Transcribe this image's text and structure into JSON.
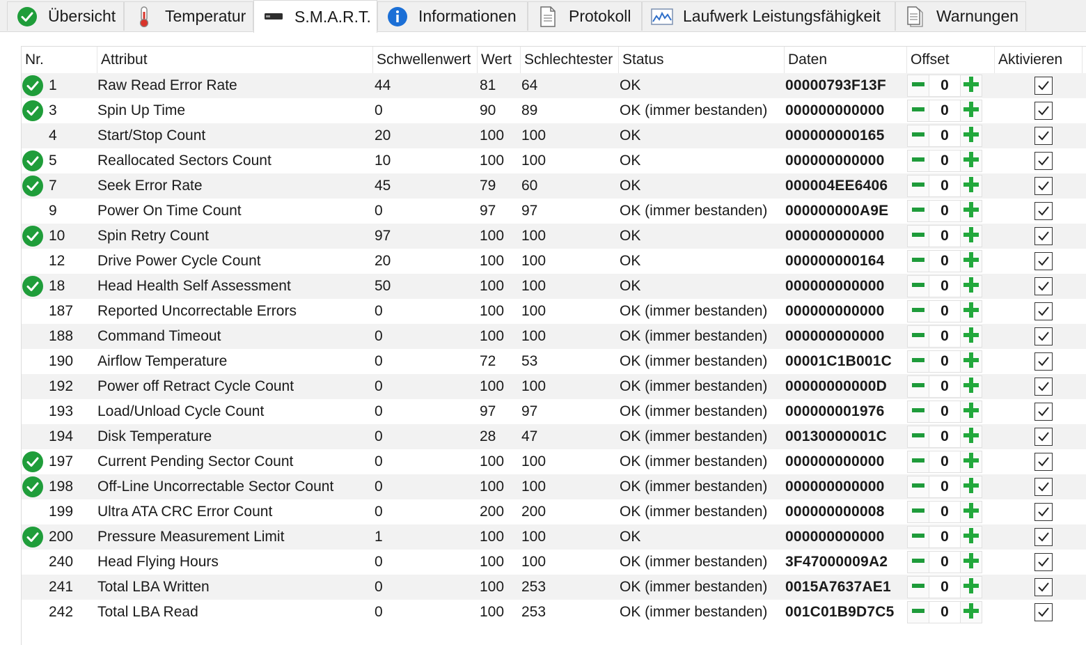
{
  "tabs": [
    {
      "label": "Übersicht",
      "icon": "check-ok-icon",
      "active": false
    },
    {
      "label": "Temperatur",
      "icon": "thermometer-icon",
      "active": false
    },
    {
      "label": "S.M.A.R.T.",
      "icon": "drive-icon",
      "active": true
    },
    {
      "label": "Informationen",
      "icon": "info-icon",
      "active": false
    },
    {
      "label": "Protokoll",
      "icon": "document-icon",
      "active": false
    },
    {
      "label": "Laufwerk Leistungsfähigkeit",
      "icon": "performance-chart-icon",
      "active": false
    },
    {
      "label": "Warnungen",
      "icon": "warnings-document-icon",
      "active": false
    }
  ],
  "columns": {
    "nr": "Nr.",
    "attribut": "Attribut",
    "schwellenwert": "Schwellenwert",
    "wert": "Wert",
    "schlechtester": "Schlechtester",
    "status": "Status",
    "daten": "Daten",
    "offset": "Offset",
    "aktivieren": "Aktivieren"
  },
  "colors": {
    "ok_green": "#1f9d3a",
    "minus_green": "#1e9b3a",
    "plus_green": "#22a83c",
    "row_alt": "#f2f2f2"
  },
  "rows": [
    {
      "ok_icon": true,
      "nr": "1",
      "attribut": "Raw Read Error Rate",
      "schwellenwert": "44",
      "wert": "81",
      "schlechtester": "64",
      "status": "OK",
      "daten": "00000793F13F",
      "offset": "0",
      "aktiv": true
    },
    {
      "ok_icon": true,
      "nr": "3",
      "attribut": "Spin Up Time",
      "schwellenwert": "0",
      "wert": "90",
      "schlechtester": "89",
      "status": "OK (immer bestanden)",
      "daten": "000000000000",
      "offset": "0",
      "aktiv": true
    },
    {
      "ok_icon": false,
      "nr": "4",
      "attribut": "Start/Stop Count",
      "schwellenwert": "20",
      "wert": "100",
      "schlechtester": "100",
      "status": "OK",
      "daten": "000000000165",
      "offset": "0",
      "aktiv": true
    },
    {
      "ok_icon": true,
      "nr": "5",
      "attribut": "Reallocated Sectors Count",
      "schwellenwert": "10",
      "wert": "100",
      "schlechtester": "100",
      "status": "OK",
      "daten": "000000000000",
      "offset": "0",
      "aktiv": true
    },
    {
      "ok_icon": true,
      "nr": "7",
      "attribut": "Seek Error Rate",
      "schwellenwert": "45",
      "wert": "79",
      "schlechtester": "60",
      "status": "OK",
      "daten": "000004EE6406",
      "offset": "0",
      "aktiv": true
    },
    {
      "ok_icon": false,
      "nr": "9",
      "attribut": "Power On Time Count",
      "schwellenwert": "0",
      "wert": "97",
      "schlechtester": "97",
      "status": "OK (immer bestanden)",
      "daten": "000000000A9E",
      "offset": "0",
      "aktiv": true
    },
    {
      "ok_icon": true,
      "nr": "10",
      "attribut": "Spin Retry Count",
      "schwellenwert": "97",
      "wert": "100",
      "schlechtester": "100",
      "status": "OK",
      "daten": "000000000000",
      "offset": "0",
      "aktiv": true
    },
    {
      "ok_icon": false,
      "nr": "12",
      "attribut": "Drive Power Cycle Count",
      "schwellenwert": "20",
      "wert": "100",
      "schlechtester": "100",
      "status": "OK",
      "daten": "000000000164",
      "offset": "0",
      "aktiv": true
    },
    {
      "ok_icon": true,
      "nr": "18",
      "attribut": "Head Health Self Assessment",
      "schwellenwert": "50",
      "wert": "100",
      "schlechtester": "100",
      "status": "OK",
      "daten": "000000000000",
      "offset": "0",
      "aktiv": true
    },
    {
      "ok_icon": false,
      "nr": "187",
      "attribut": "Reported Uncorrectable Errors",
      "schwellenwert": "0",
      "wert": "100",
      "schlechtester": "100",
      "status": "OK (immer bestanden)",
      "daten": "000000000000",
      "offset": "0",
      "aktiv": true
    },
    {
      "ok_icon": false,
      "nr": "188",
      "attribut": "Command Timeout",
      "schwellenwert": "0",
      "wert": "100",
      "schlechtester": "100",
      "status": "OK (immer bestanden)",
      "daten": "000000000000",
      "offset": "0",
      "aktiv": true
    },
    {
      "ok_icon": false,
      "nr": "190",
      "attribut": "Airflow Temperature",
      "schwellenwert": "0",
      "wert": "72",
      "schlechtester": "53",
      "status": "OK (immer bestanden)",
      "daten": "00001C1B001C",
      "offset": "0",
      "aktiv": true
    },
    {
      "ok_icon": false,
      "nr": "192",
      "attribut": "Power off Retract Cycle Count",
      "schwellenwert": "0",
      "wert": "100",
      "schlechtester": "100",
      "status": "OK (immer bestanden)",
      "daten": "00000000000D",
      "offset": "0",
      "aktiv": true
    },
    {
      "ok_icon": false,
      "nr": "193",
      "attribut": "Load/Unload Cycle Count",
      "schwellenwert": "0",
      "wert": "97",
      "schlechtester": "97",
      "status": "OK (immer bestanden)",
      "daten": "000000001976",
      "offset": "0",
      "aktiv": true
    },
    {
      "ok_icon": false,
      "nr": "194",
      "attribut": "Disk Temperature",
      "schwellenwert": "0",
      "wert": "28",
      "schlechtester": "47",
      "status": "OK (immer bestanden)",
      "daten": "00130000001C",
      "offset": "0",
      "aktiv": true
    },
    {
      "ok_icon": true,
      "nr": "197",
      "attribut": "Current Pending Sector Count",
      "schwellenwert": "0",
      "wert": "100",
      "schlechtester": "100",
      "status": "OK (immer bestanden)",
      "daten": "000000000000",
      "offset": "0",
      "aktiv": true
    },
    {
      "ok_icon": true,
      "nr": "198",
      "attribut": "Off-Line Uncorrectable Sector Count",
      "schwellenwert": "0",
      "wert": "100",
      "schlechtester": "100",
      "status": "OK (immer bestanden)",
      "daten": "000000000000",
      "offset": "0",
      "aktiv": true
    },
    {
      "ok_icon": false,
      "nr": "199",
      "attribut": "Ultra ATA CRC Error Count",
      "schwellenwert": "0",
      "wert": "200",
      "schlechtester": "200",
      "status": "OK (immer bestanden)",
      "daten": "000000000008",
      "offset": "0",
      "aktiv": true
    },
    {
      "ok_icon": true,
      "nr": "200",
      "attribut": "Pressure Measurement Limit",
      "schwellenwert": "1",
      "wert": "100",
      "schlechtester": "100",
      "status": "OK",
      "daten": "000000000000",
      "offset": "0",
      "aktiv": true
    },
    {
      "ok_icon": false,
      "nr": "240",
      "attribut": "Head Flying Hours",
      "schwellenwert": "0",
      "wert": "100",
      "schlechtester": "100",
      "status": "OK (immer bestanden)",
      "daten": "3F47000009A2",
      "offset": "0",
      "aktiv": true
    },
    {
      "ok_icon": false,
      "nr": "241",
      "attribut": "Total LBA Written",
      "schwellenwert": "0",
      "wert": "100",
      "schlechtester": "253",
      "status": "OK (immer bestanden)",
      "daten": "0015A7637AE1",
      "offset": "0",
      "aktiv": true
    },
    {
      "ok_icon": false,
      "nr": "242",
      "attribut": "Total LBA Read",
      "schwellenwert": "0",
      "wert": "100",
      "schlechtester": "253",
      "status": "OK (immer bestanden)",
      "daten": "001C01B9D7C5",
      "offset": "0",
      "aktiv": true
    }
  ]
}
